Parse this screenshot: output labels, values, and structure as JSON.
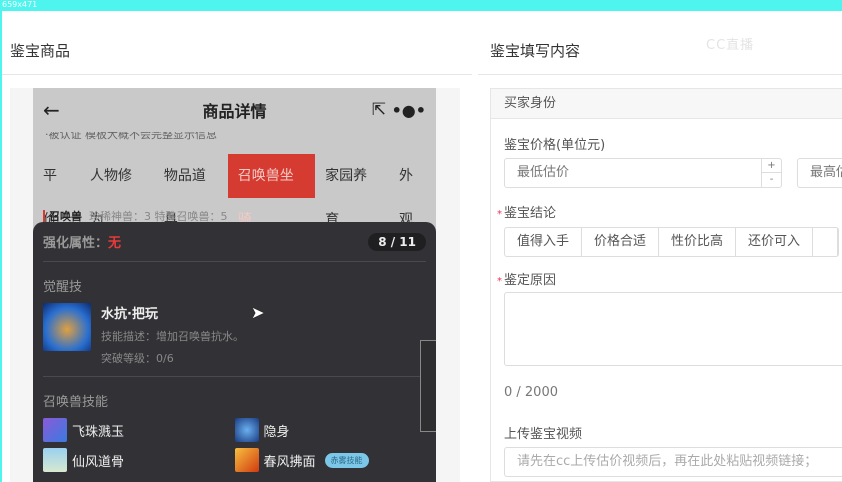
{
  "topbar": {
    "size_text": "659x471"
  },
  "left": {
    "title": "鉴宝商品"
  },
  "phone": {
    "nav_title": "商品详情",
    "notice": "·被认证  模板大概不会完整显示信息",
    "tabs": [
      "平价",
      "人物修为",
      "物品道具",
      "召唤兽坐骑",
      "家园养育",
      "外观"
    ],
    "active_tab": "召唤兽坐骑",
    "sub_label": "召唤兽",
    "sub_info": "珍稀神兽：3  特殊召唤兽：5",
    "popup": {
      "attr_label": "强化属性：",
      "attr_value": "无",
      "page": "8 / 11",
      "awaken_title": "觉醒技",
      "awaken_name": "水抗·把玩",
      "awaken_desc": "技能描述：增加召唤兽抗水。",
      "awaken_level": "突破等级：0/6",
      "skills_title": "召唤兽技能",
      "skills": [
        {
          "name": "飞珠溅玉"
        },
        {
          "name": "隐身"
        },
        {
          "name": "仙风道骨"
        },
        {
          "name": "春风拂面",
          "tag": "赤雾技能"
        }
      ]
    }
  },
  "right": {
    "title": "鉴宝填写内容",
    "watermark": "CC直播",
    "buyer_identity": "买家身份",
    "price_label": "鉴宝价格(单位元)",
    "min_placeholder": "最低估价",
    "max_placeholder": "最高估价",
    "conclusion_label": "鉴宝结论",
    "conclusions": [
      "值得入手",
      "价格合适",
      "性价比高",
      "还价可入"
    ],
    "reason_label": "鉴定原因",
    "counter": "0 / 2000",
    "video_label": "上传鉴宝视频",
    "video_placeholder": "请先在cc上传估价视频后，再在此处粘贴视频链接；"
  },
  "colors": {
    "accent": "#d63b32",
    "cyan": "#4ef5ee"
  }
}
